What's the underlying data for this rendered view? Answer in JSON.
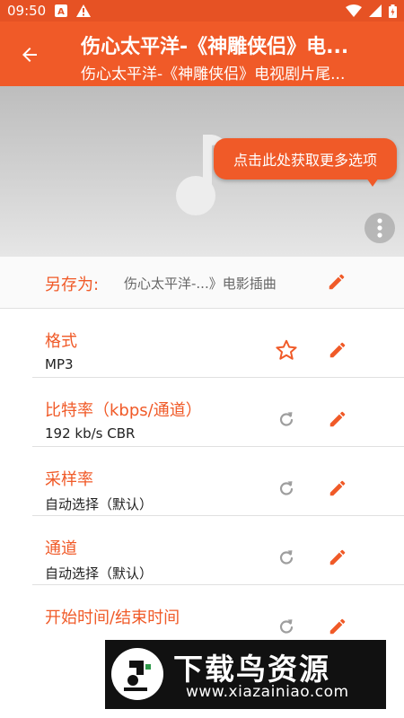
{
  "status_bar": {
    "time": "09:50",
    "icons": [
      "font-a-icon",
      "warning-icon",
      "wifi-icon",
      "signal-icon",
      "battery-icon"
    ]
  },
  "app_bar": {
    "title": "伤心太平洋-《神雕侠侣》电...",
    "subtitle": "伤心太平洋-《神雕侠侣》电视剧片尾..."
  },
  "tooltip": {
    "text": "点击此处获取更多选项"
  },
  "save_as": {
    "label": "另存为:",
    "value": "伤心太平洋-...》电影插曲"
  },
  "settings": [
    {
      "label": "格式",
      "value": "MP3",
      "left_icon": "star-outline-icon"
    },
    {
      "label": "比特率（kbps/通道）",
      "value": "192 kb/s CBR",
      "left_icon": "reset-icon"
    },
    {
      "label": "采样率",
      "value": "自动选择（默认）",
      "left_icon": "reset-icon"
    },
    {
      "label": "通道",
      "value": "自动选择（默认）",
      "left_icon": "reset-icon"
    },
    {
      "label": "开始时间/结束时间",
      "value": "",
      "left_icon": "reset-icon"
    }
  ],
  "watermark": {
    "title": "下载鸟资源",
    "url": "www.xiazainiao.com"
  },
  "colors": {
    "primary": "#f05a28",
    "status_bar": "#e65224",
    "icon_gray": "#9e9e9e"
  }
}
